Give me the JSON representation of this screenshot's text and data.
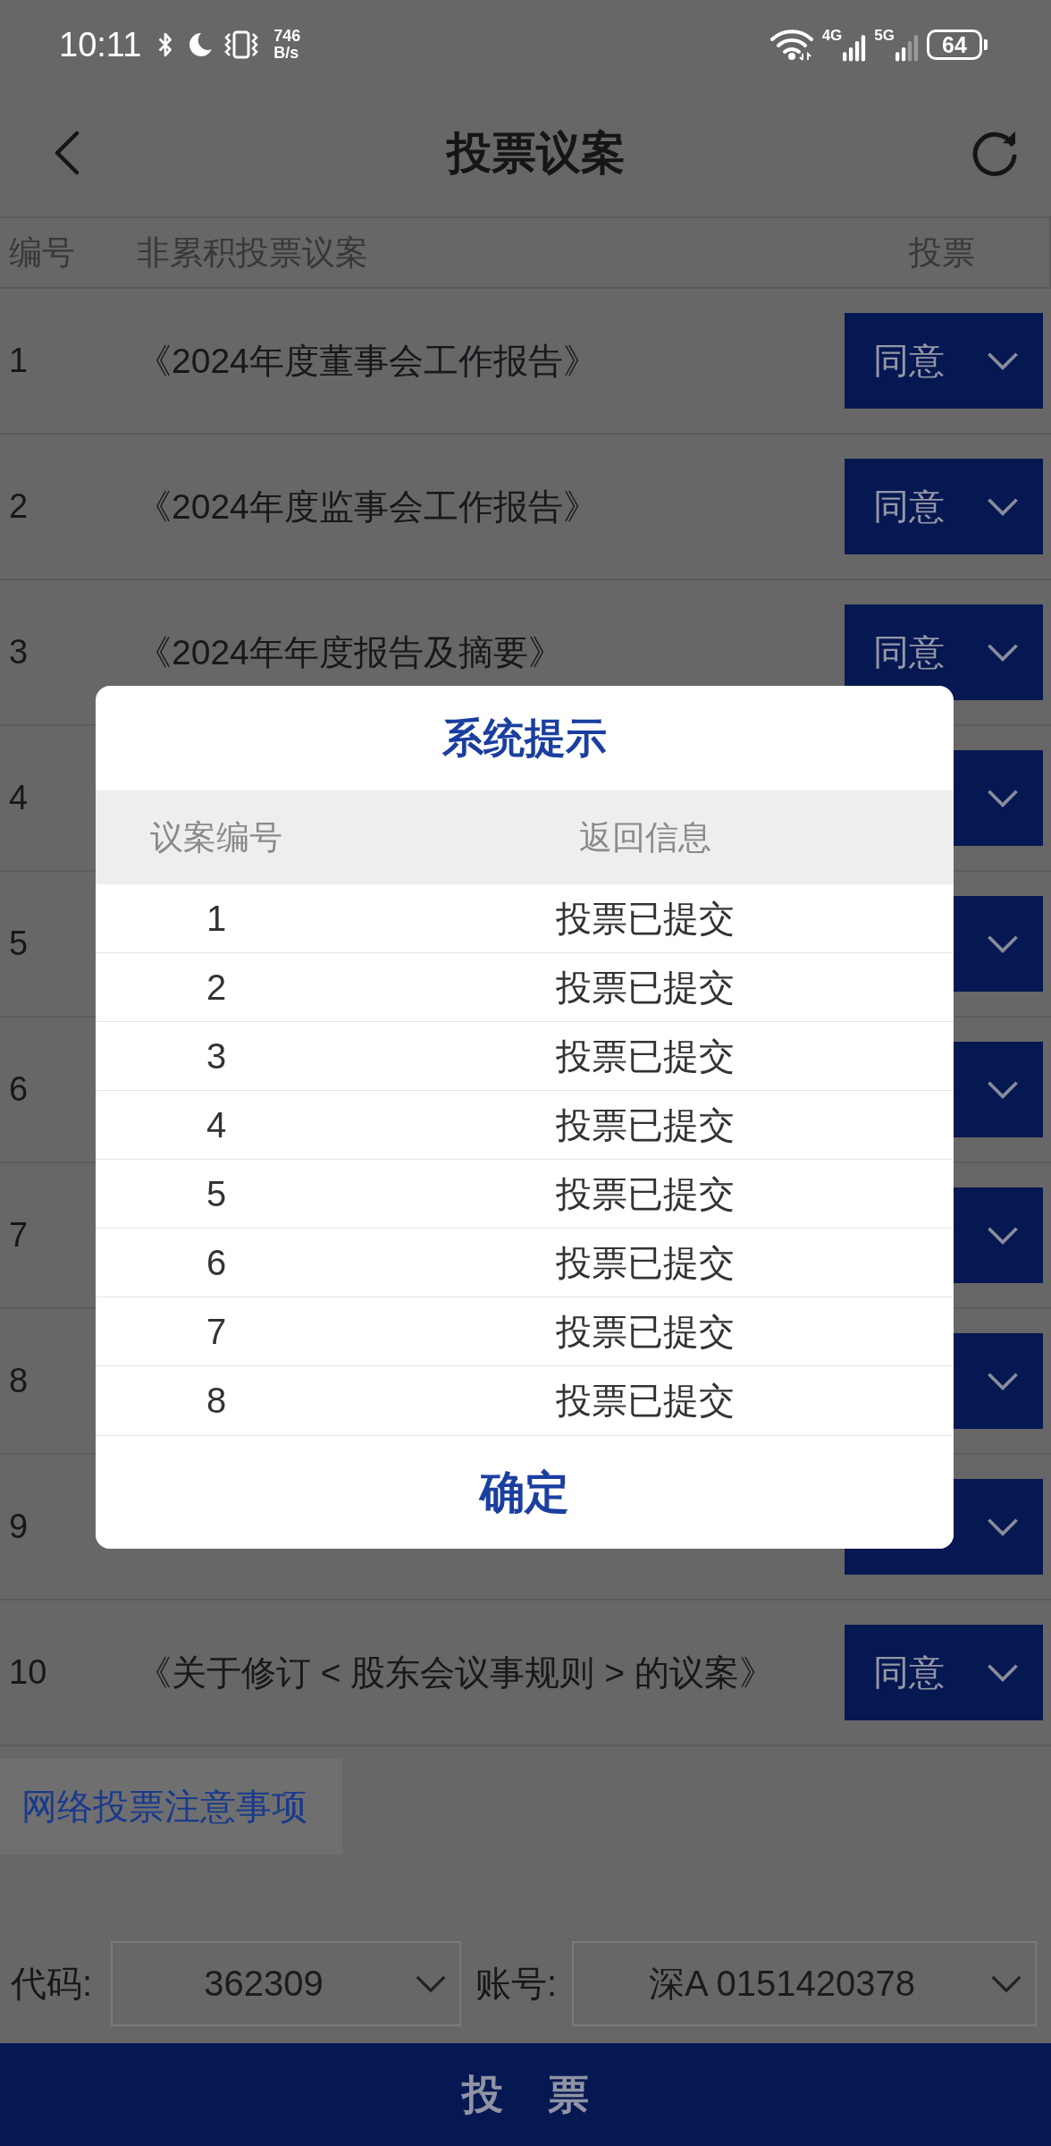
{
  "status_bar": {
    "time": "10:11",
    "net_speed_value": "746",
    "net_speed_unit": "B/s",
    "network_4g": "4G",
    "network_5g": "5G",
    "battery": "64"
  },
  "header": {
    "title": "投票议案"
  },
  "table": {
    "columns": [
      "编号",
      "非累积投票议案",
      "投票"
    ],
    "rows": [
      {
        "number": "1",
        "title": "《2024年度董事会工作报告》",
        "vote": "同意"
      },
      {
        "number": "2",
        "title": "《2024年度监事会工作报告》",
        "vote": "同意"
      },
      {
        "number": "3",
        "title": "《2024年年度报告及摘要》",
        "vote": "同意"
      },
      {
        "number": "4"
      },
      {
        "number": "5"
      },
      {
        "number": "6"
      },
      {
        "number": "7"
      },
      {
        "number": "8"
      },
      {
        "number": "9"
      },
      {
        "number": "10",
        "title": "《关于修订 < 股东会议事规则 > 的议案》",
        "vote": "同意"
      }
    ]
  },
  "notice_link": "网络投票注意事项",
  "selectors": [
    {
      "label": "代码:",
      "value": "362309"
    },
    {
      "label": "账号:",
      "value": "深A 0151420378"
    }
  ],
  "submit_button": "投 票",
  "dialog": {
    "title": "系统提示",
    "columns": [
      "议案编号",
      "返回信息"
    ],
    "rows": [
      {
        "number": "1",
        "message": "投票已提交"
      },
      {
        "number": "2",
        "message": "投票已提交"
      },
      {
        "number": "3",
        "message": "投票已提交"
      },
      {
        "number": "4",
        "message": "投票已提交"
      },
      {
        "number": "5",
        "message": "投票已提交"
      },
      {
        "number": "6",
        "message": "投票已提交"
      },
      {
        "number": "7",
        "message": "投票已提交"
      },
      {
        "number": "8",
        "message": "投票已提交"
      }
    ],
    "confirm": "确定"
  }
}
